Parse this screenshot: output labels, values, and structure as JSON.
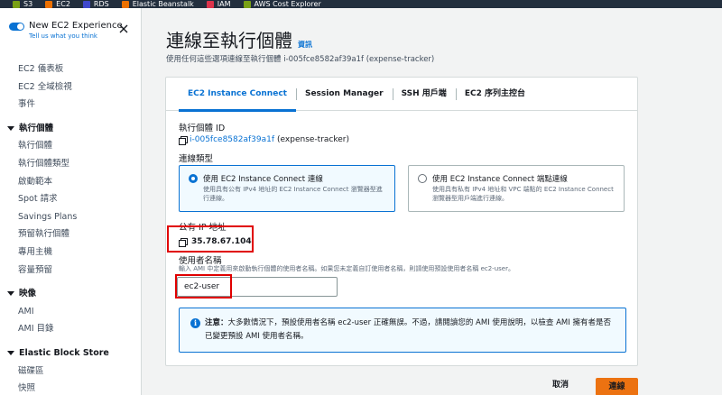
{
  "favorites": [
    {
      "label": "S3",
      "icon": "s3-icon",
      "color": "#7aa116"
    },
    {
      "label": "EC2",
      "icon": "ec2-icon",
      "color": "#ed7100"
    },
    {
      "label": "RDS",
      "icon": "rds-icon",
      "color": "#3f48cc"
    },
    {
      "label": "Elastic Beanstalk",
      "icon": "beanstalk-icon",
      "color": "#ed7100"
    },
    {
      "label": "IAM",
      "icon": "iam-icon",
      "color": "#dd344c"
    },
    {
      "label": "AWS Cost Explorer",
      "icon": "cost-explorer-icon",
      "color": "#7aa116"
    }
  ],
  "sidebar": {
    "experience_title": "New EC2 Experience",
    "experience_link": "Tell us what you think",
    "top_items": [
      "EC2 儀表板",
      "EC2 全域檢視",
      "事件"
    ],
    "sections": [
      {
        "title": "執行個體",
        "items": [
          "執行個體",
          "執行個體類型",
          "啟動範本",
          "Spot 請求",
          "Savings Plans",
          "預留執行個體",
          "專用主機",
          "容量預留"
        ]
      },
      {
        "title": "映像",
        "items": [
          "AMI",
          "AMI 目錄"
        ]
      },
      {
        "title": "Elastic Block Store",
        "items": [
          "磁碟區",
          "快照"
        ]
      }
    ]
  },
  "page": {
    "title": "連線至執行個體",
    "info": "資訊",
    "description": "使用任何這些選項連線至執行個體 i-005fce8582af39a1f (expense-tracker)"
  },
  "tabs": [
    "EC2 Instance Connect",
    "Session Manager",
    "SSH 用戶端",
    "EC2 序列主控台"
  ],
  "form": {
    "instance_id_label": "執行個體 ID",
    "instance_id": "i-005fce8582af39a1f",
    "instance_name": "(expense-tracker)",
    "connection_type_label": "連線類型",
    "options": [
      {
        "title": "使用 EC2 Instance Connect 連線",
        "desc": "使用具有公有 IPv4 地址的 EC2 Instance Connect 瀏覽器型進行連線。",
        "selected": true
      },
      {
        "title": "使用 EC2 Instance Connect 端點連線",
        "desc": "使用具有私有 IPv4 地址和 VPC 端點的 EC2 Instance Connect 瀏覽器型用戶端進行連線。",
        "selected": false
      }
    ],
    "public_ip_label": "公有 IP 地址",
    "public_ip": "35.78.67.104",
    "username_label": "使用者名稱",
    "username_desc": "輸入 AMI 中定義用來啟動執行個體的使用者名稱。如果您未定義自訂使用者名稱，則請使用預設使用者名稱 ec2-user。",
    "username_value": "ec2-user"
  },
  "alert": {
    "bold": "注意：",
    "text": "大多數情況下，預設使用者名稱 ec2-user 正確無誤。不過，請閱讀您的 AMI 使用說明，以檢查 AMI 擁有者是否已變更預設 AMI 使用者名稱。"
  },
  "footer": {
    "cancel": "取消",
    "connect": "連線"
  }
}
